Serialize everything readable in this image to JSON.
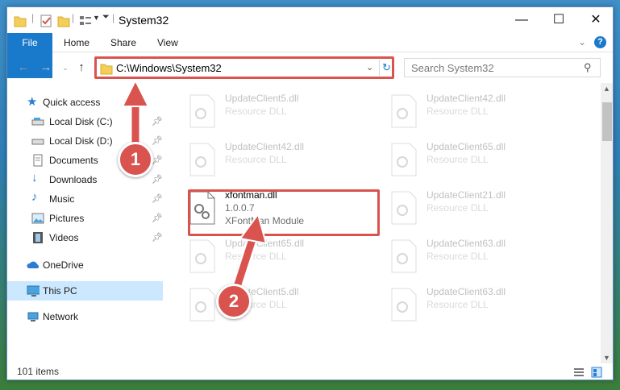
{
  "window": {
    "title": "System32"
  },
  "ribbon": {
    "tabs": [
      {
        "label": "File"
      },
      {
        "label": "Home"
      },
      {
        "label": "Share"
      },
      {
        "label": "View"
      }
    ]
  },
  "address": {
    "path": "C:\\Windows\\System32"
  },
  "search": {
    "placeholder": "Search System32"
  },
  "sidebar": {
    "items": [
      {
        "label": "Quick access",
        "icon": "star-icon"
      },
      {
        "label": "Local Disk (C:)",
        "icon": "drive-icon",
        "pinned": true
      },
      {
        "label": "Local Disk (D:)",
        "icon": "drive-icon",
        "pinned": true
      },
      {
        "label": "Documents",
        "icon": "documents-icon",
        "pinned": true
      },
      {
        "label": "Downloads",
        "icon": "downloads-icon",
        "pinned": true
      },
      {
        "label": "Music",
        "icon": "music-icon",
        "pinned": true
      },
      {
        "label": "Pictures",
        "icon": "pictures-icon",
        "pinned": true
      },
      {
        "label": "Videos",
        "icon": "videos-icon",
        "pinned": true
      },
      {
        "label": "OneDrive",
        "icon": "cloud-icon"
      },
      {
        "label": "This PC",
        "icon": "pc-icon",
        "selected": true
      },
      {
        "label": "Network",
        "icon": "network-icon"
      }
    ]
  },
  "files": [
    {
      "name": "UpdateClient5.dll",
      "type": "Resource DLL"
    },
    {
      "name": "UpdateClient42.dll",
      "type": "Resource DLL"
    },
    {
      "name": "UpdateClient42.dll",
      "type": "Resource DLL"
    },
    {
      "name": "UpdateClient65.dll",
      "type": "Resource DLL"
    },
    {
      "name": "xfontman.dll",
      "version": "1.0.0.7",
      "type": "XFontMan Module"
    },
    {
      "name": "UpdateClient21.dll",
      "type": "Resource DLL"
    },
    {
      "name": "UpdateClient65.dll",
      "type": "Resource DLL"
    },
    {
      "name": "UpdateClient63.dll",
      "type": "Resource DLL"
    },
    {
      "name": "UpdateClient5.dll",
      "type": "Resource DLL"
    },
    {
      "name": "UpdateClient63.dll",
      "type": "Resource DLL"
    }
  ],
  "status": {
    "item_count": "101 items"
  },
  "callouts": [
    {
      "label": "1"
    },
    {
      "label": "2"
    }
  ],
  "colors": {
    "accent": "#1979ca",
    "highlight": "#d9534f",
    "selection": "#cce8ff"
  }
}
